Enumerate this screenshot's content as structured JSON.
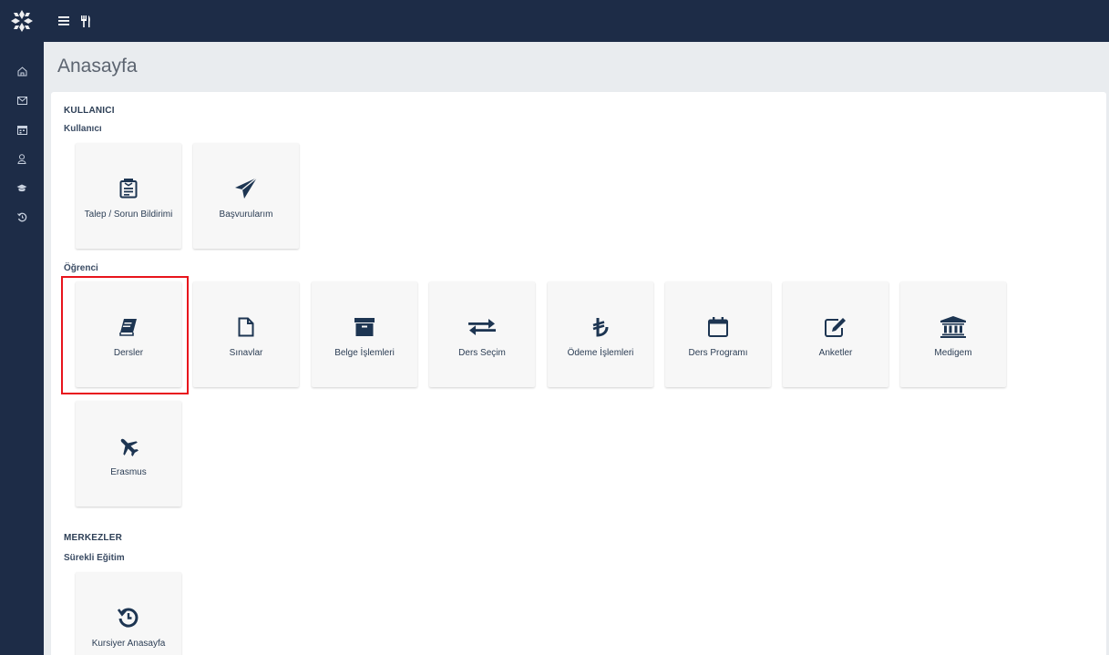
{
  "topbar": {
    "logo_icon": "university-logo",
    "menu_icon": "hamburger-icon",
    "cutlery_icon": "cutlery-icon"
  },
  "sidebar": {
    "items": [
      {
        "icon": "home-icon"
      },
      {
        "icon": "mail-icon"
      },
      {
        "icon": "calendar-icon"
      },
      {
        "icon": "user-icon"
      },
      {
        "icon": "graduation-cap-icon"
      },
      {
        "icon": "history-icon"
      }
    ]
  },
  "page": {
    "title": "Anasayfa"
  },
  "sections": {
    "kullanici": {
      "title": "KULLANICI",
      "group": "Kullanıcı",
      "tiles": [
        "Talep / Sorun Bildirimi",
        "Başvurularım"
      ]
    },
    "ogrenci": {
      "group": "Öğrenci",
      "tiles": [
        "Dersler",
        "Sınavlar",
        "Belge İşlemleri",
        "Ders Seçim",
        "Ödeme İşlemleri",
        "Ders Programı",
        "Anketler",
        "Medigem",
        "Erasmus"
      ]
    },
    "merkezler": {
      "title": "MERKEZLER",
      "group": "Sürekli Eğitim",
      "tiles": [
        "Kursiyer Anasayfa"
      ]
    }
  },
  "colors": {
    "nav_bg": "#1d2c47",
    "icon": "#1d3552",
    "highlight": "#e8141c"
  }
}
